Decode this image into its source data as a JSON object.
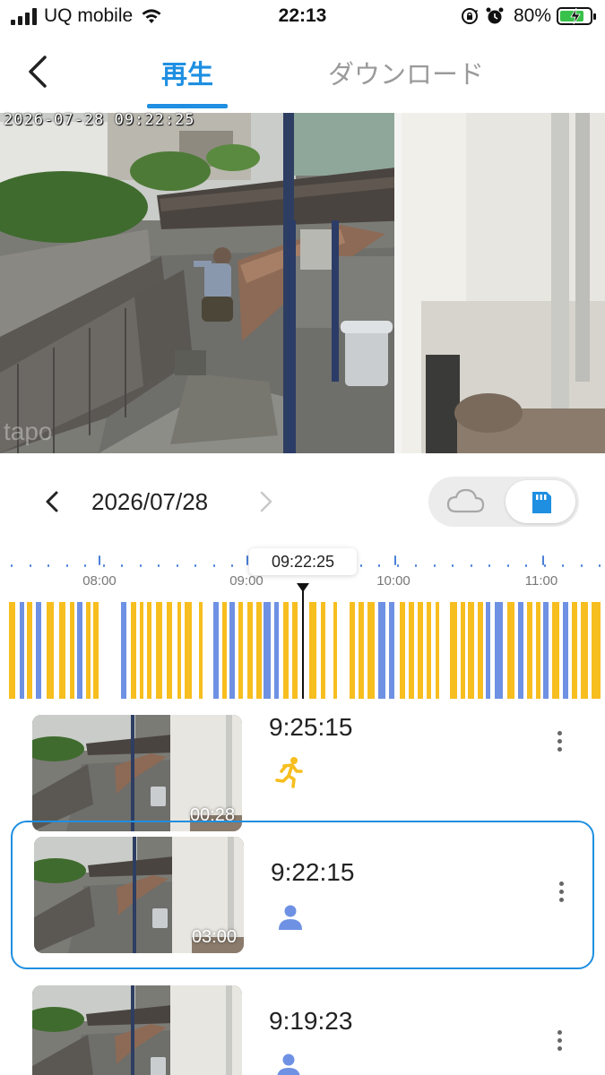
{
  "status_bar": {
    "carrier": "UQ mobile",
    "time": "22:13",
    "battery_percent": "80%",
    "battery_level": 0.8,
    "icons": [
      "signal-icon",
      "wifi-icon",
      "orientation-lock-icon",
      "alarm-icon",
      "battery-charging-icon"
    ]
  },
  "nav": {
    "back_icon": "chevron-left-icon",
    "tabs": [
      {
        "label": "再生",
        "active": true
      },
      {
        "label": "ダウンロード",
        "active": false
      }
    ]
  },
  "video": {
    "timestamp": "2026-07-28 09:22:25",
    "watermark": "tapo"
  },
  "date_selector": {
    "date": "2026/07/28",
    "prev_icon": "chevron-left-icon",
    "next_icon": "chevron-right-icon",
    "storage_options": [
      {
        "name": "cloud-icon",
        "selected": false
      },
      {
        "name": "sd-card-icon",
        "selected": true
      }
    ]
  },
  "timeline": {
    "current_time": "09:22:25",
    "hour_labels": [
      "08:00",
      "09:00",
      "10:00",
      "11:00"
    ],
    "colors": {
      "motion": "#f7be1f",
      "person": "#6e91e3",
      "background": "#ffffff",
      "tick": "#4a7fd8"
    }
  },
  "clips": [
    {
      "time": "9:25:15",
      "duration": "00:28",
      "event_icon": "running-person-icon",
      "event_color": "#f7be1f",
      "selected": false
    },
    {
      "time": "9:22:15",
      "duration": "03:00",
      "event_icon": "person-icon",
      "event_color": "#6e91e3",
      "selected": true
    },
    {
      "time": "9:19:23",
      "duration": "",
      "event_icon": "person-icon",
      "event_color": "#6e91e3",
      "selected": false
    }
  ],
  "accent_color": "#1e8fe1"
}
